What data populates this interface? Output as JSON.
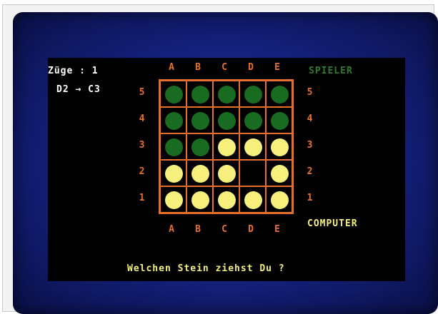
{
  "status": {
    "moves_label": "Züge : 1",
    "last_move": "D2 → C3"
  },
  "players": {
    "top": "SPIELER",
    "bottom": "COMPUTER"
  },
  "prompt": "Welchen Stein ziehst Du ?",
  "board": {
    "columns": [
      "A",
      "B",
      "C",
      "D",
      "E"
    ],
    "rows": [
      "5",
      "4",
      "3",
      "2",
      "1"
    ],
    "cells": [
      [
        "green",
        "green",
        "green",
        "green",
        "green"
      ],
      [
        "green",
        "green",
        "green",
        "green",
        "green"
      ],
      [
        "green",
        "green",
        "yellow",
        "yellow",
        "yellow"
      ],
      [
        "yellow",
        "yellow",
        "yellow",
        "empty",
        "yellow"
      ],
      [
        "yellow",
        "yellow",
        "yellow",
        "yellow",
        "yellow"
      ]
    ]
  },
  "colors": {
    "grid": "#e8702a",
    "player_piece": "#1a6b22",
    "computer_piece": "#f7f07c",
    "background": "#000000"
  }
}
